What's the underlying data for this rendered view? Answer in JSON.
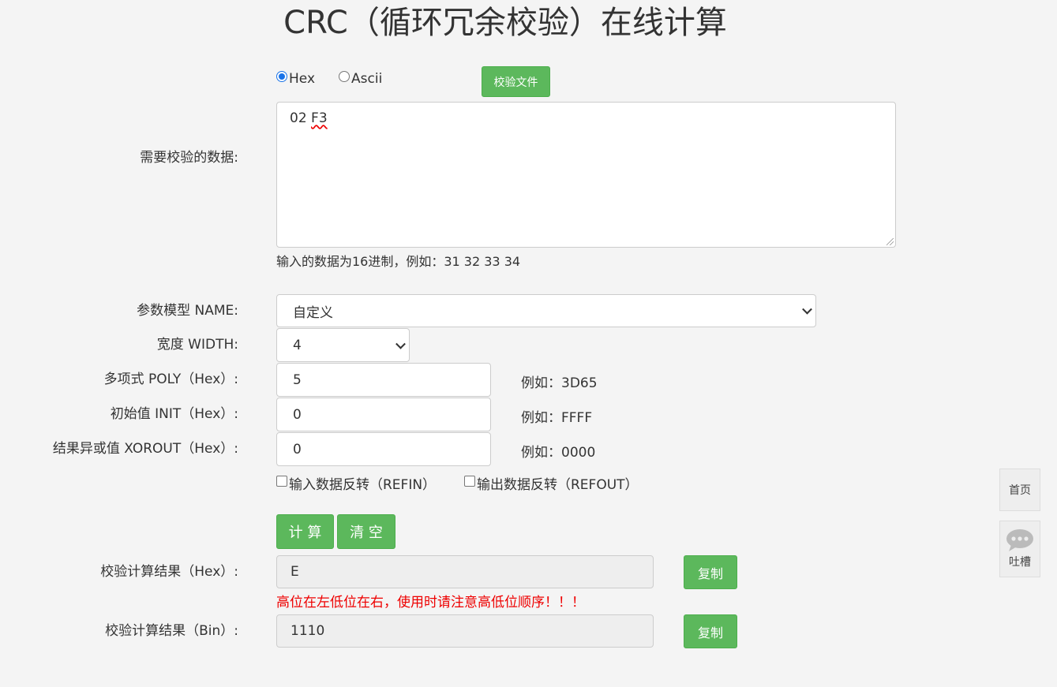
{
  "title": "CRC（循环冗余校验）在线计算",
  "input_mode": {
    "options": [
      "Hex",
      "Ascii"
    ],
    "selected": "Hex",
    "file_button": "校验文件"
  },
  "data_input": {
    "label": "需要校验的数据:",
    "value_prefix": "02 ",
    "value_misspelled": "F3",
    "hint": "输入的数据为16进制，例如：31 32 33 34"
  },
  "params": {
    "model": {
      "label": "参数模型 NAME:",
      "value": "自定义"
    },
    "width": {
      "label": "宽度 WIDTH:",
      "value": "4"
    },
    "poly": {
      "label": "多项式 POLY（Hex）:",
      "value": "5",
      "example": "例如：3D65"
    },
    "init": {
      "label": "初始值 INIT（Hex）:",
      "value": "0",
      "example": "例如：FFFF"
    },
    "xorout": {
      "label": "结果异或值 XOROUT（Hex）:",
      "value": "0",
      "example": "例如：0000"
    },
    "refin": "输入数据反转（REFIN）",
    "refout": "输出数据反转（REFOUT）"
  },
  "actions": {
    "calculate": "计 算",
    "clear": "清 空"
  },
  "results": {
    "hex": {
      "label": "校验计算结果（Hex）:",
      "value": "E",
      "copy": "复制"
    },
    "warning": "高位在左低位在右，使用时请注意高低位顺序！！！",
    "bin": {
      "label": "校验计算结果（Bin）:",
      "value": "1110",
      "copy": "复制"
    }
  },
  "sidebar": {
    "home": "首页",
    "feedback": "吐槽"
  },
  "colors": {
    "green": "#5cb85c",
    "warning": "#e00000",
    "radio_selected": "#1a73e8"
  }
}
